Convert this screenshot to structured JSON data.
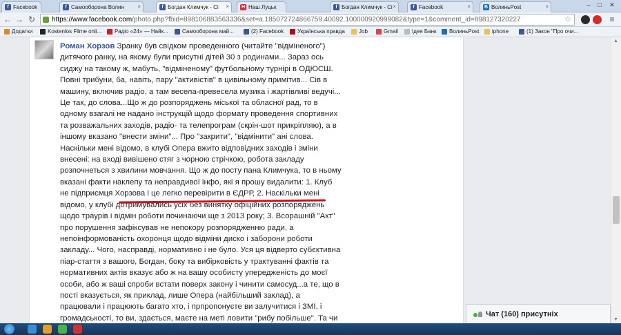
{
  "browser": {
    "tabs": [
      {
        "label": "Facebook"
      },
      {
        "label": "Самооборона Волин"
      },
      {
        "label": "Богдан Климчук - Сі"
      },
      {
        "label": "Наш Луцьк"
      },
      {
        "label": "Богдан Климчук - Сі"
      },
      {
        "label": "Facebook"
      },
      {
        "label": "ВолиньPost"
      }
    ],
    "url_host": "https://www.facebook.com",
    "url_path": "/photo.php?fbid=898106883563336&set=a.185072724866759.40092.100000920999082&type=1&comment_id=8981273202​27",
    "bookmarks": [
      "Додатки",
      "Kostenlos Filme onli...",
      "Радіо «24» — Найк...",
      "Самооборона май...",
      "(2) Facebook",
      "Українська правда",
      "Job",
      "Gmail",
      "Ідея Банк",
      "ВолиньPost",
      "iphone",
      "(1) Закон \"Про очи..."
    ]
  },
  "comment": {
    "author": "Роман Хорзов",
    "text": "Зранку був свідком проведенного (читайте \"відміненого\") дитячого ранку, на якому були присутні дітей 30 з родинами... Зараз ось сиджу на такому ж, мабуть, \"відміненому\" футбольному турнірі в ОДЮСШ. Повні трибуни, ба, навіть, пару \"активістів\" в цивільному примітив... Сів в машину, включив радіо, а там весела-превесела музика і жартівливі ведучі... Це так, до слова...Що ж до розпоряджень міської та обласної рад, то в одному взагалі не надано інструкцій щодо формату проведення спортивних та розважальних заходів, радіо- та телепрограм (скрін-шот прикріпляю), а в іншому вказано \"внести зміни\"... Про \"закрити\", \"відмінити\" ані слова. Наскільки мені відомо, в клубі Опера вжито відповідних заходів і зміни внесені: на вході вивішено стяг з чорною стрічкою, робота закладу розпочнеться з хвилини мовчання. Що ж до посту пана Климчука, то в ньому вказані факти наклепу та неправдивої інфо, які я прошу видалити: 1. Клуб не підприємця Хорзова і це легко перевірити в ЄДРР, 2. Наскільки мені відомо, у клубі дотримувались усіх без винятку офіційних розпоряджень щодо траурів і відмін роботи починаючи ще з 2013 року; 3. Всорашній \"Акт\" про порушення зафіксував не непокору розпорядженню ради, а непоінформованість охоронця щодо відміни диско і заборони роботи закладу... Чого, насправді, нормативно і не було. Уся ця відверто субєктивна піар-стаття з вашого, Богдан, боку та вибірковість у трактуванні фактів та нормативних актів вказує або ж на вашу особисту упередженість до моєї особи, або ж ваші спроби встати поверх закону і чинити самосуд...а те, що в пості вказується, як приклад, лише Опера (найбільший заклад), а працювали і працюють багато хто, і прпропонуєте ви залучитися і ЗМІ, і громадськості, то ви, здається, маєте на меті ловити \"рибу побільше\". Та чи не з корисливих та піар-мотивів?"
  },
  "chat": {
    "label": "Чат (160) присутніх"
  }
}
